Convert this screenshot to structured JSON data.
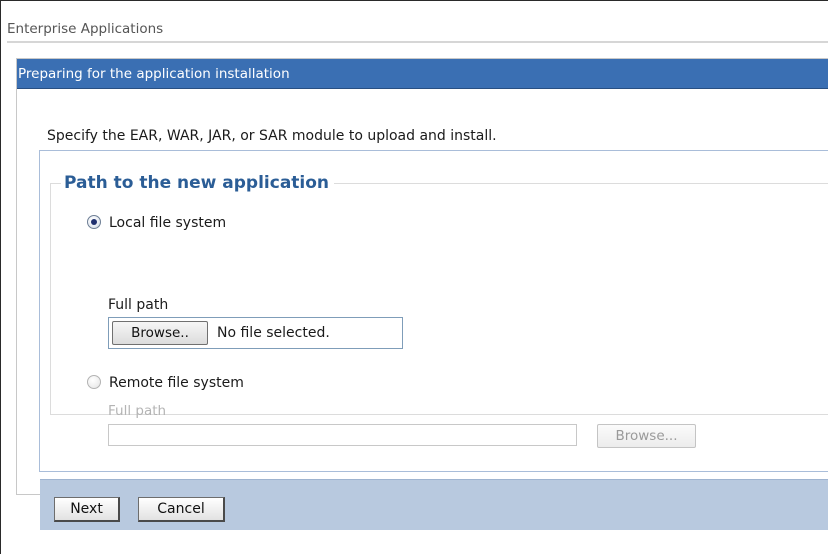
{
  "breadcrumb": {
    "title": "Enterprise Applications"
  },
  "wizard": {
    "title": "Preparing for the application installation",
    "instruction": "Specify the EAR, WAR, JAR, or SAR module to upload and install.",
    "section": {
      "legend": "Path to the new application",
      "local": {
        "label": "Local file system",
        "selected": true,
        "full_path_label": "Full path",
        "browse_label": "Browse..",
        "file_status": "No file selected."
      },
      "remote": {
        "label": "Remote file system",
        "selected": false,
        "full_path_label": "Full path",
        "path_value": "",
        "browse_label": "Browse..."
      }
    },
    "buttons": {
      "next": "Next",
      "cancel": "Cancel"
    }
  },
  "colors": {
    "title_bar": "#3a6fb3",
    "legend_text": "#2b5d96",
    "button_bar": "#b8c9df"
  }
}
